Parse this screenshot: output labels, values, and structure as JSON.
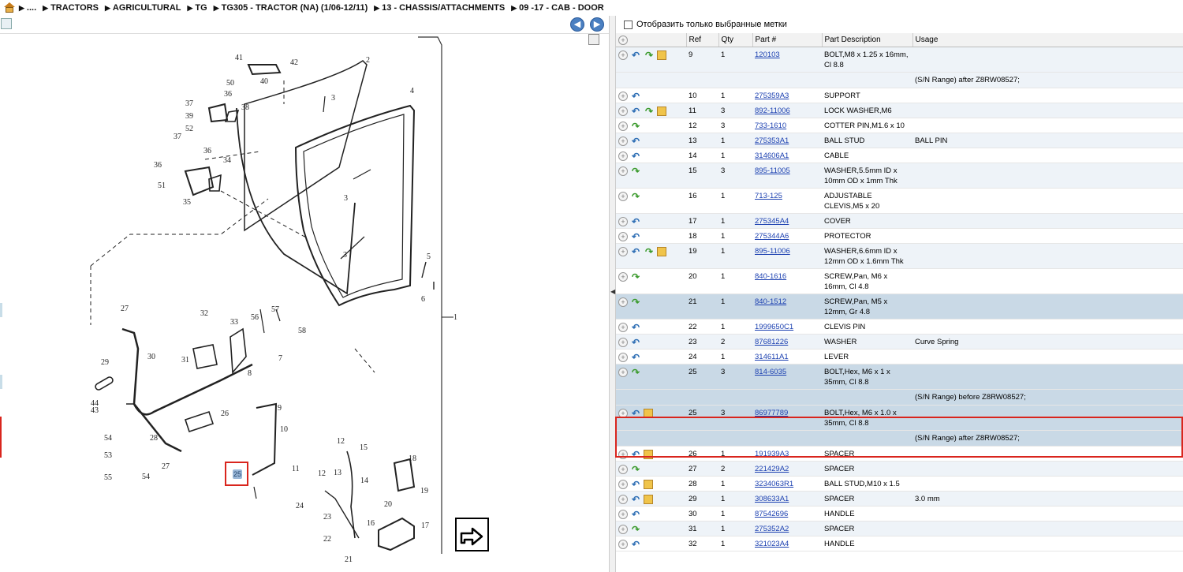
{
  "breadcrumb": {
    "items": [
      "....",
      "TRACTORS",
      "AGRICULTURAL",
      "TG",
      "TG305 - TRACTOR (NA) (1/06-12/11)",
      "13 - CHASSIS/ATTACHMENTS",
      "09 -17 - CAB - DOOR"
    ]
  },
  "nav": {
    "back": "◀",
    "forward": "▶"
  },
  "filter": {
    "label": "Отобразить только выбранные метки"
  },
  "table": {
    "headers": [
      "Ref",
      "Qty",
      "Part #",
      "Part Description",
      "Usage"
    ],
    "rows": [
      {
        "icons": [
          "plus",
          "back",
          "fwd",
          "box"
        ],
        "ref": "9",
        "qty": "1",
        "part": "120103",
        "desc": "BOLT,M8 x 1.25 x 16mm, Cl 8.8",
        "usage": "",
        "style": "alt"
      },
      {
        "range": "(S/N Range) after Z8RW08527;",
        "style": "alt"
      },
      {
        "icons": [
          "plus",
          "back"
        ],
        "ref": "10",
        "qty": "1",
        "part": "275359A3",
        "desc": "SUPPORT",
        "usage": "",
        "style": "white"
      },
      {
        "icons": [
          "plus",
          "back",
          "fwd",
          "box"
        ],
        "ref": "11",
        "qty": "3",
        "part": "892-11006",
        "desc": "LOCK WASHER,M6",
        "usage": "",
        "style": "alt"
      },
      {
        "icons": [
          "plus",
          "fwd"
        ],
        "ref": "12",
        "qty": "3",
        "part": "733-1610",
        "desc": "COTTER PIN,M1.6 x 10",
        "usage": "",
        "style": "white"
      },
      {
        "icons": [
          "plus",
          "back"
        ],
        "ref": "13",
        "qty": "1",
        "part": "275353A1",
        "desc": "BALL STUD",
        "usage": "BALL PIN",
        "style": "alt"
      },
      {
        "icons": [
          "plus",
          "back"
        ],
        "ref": "14",
        "qty": "1",
        "part": "314606A1",
        "desc": "CABLE",
        "usage": "",
        "style": "white"
      },
      {
        "icons": [
          "plus",
          "fwd"
        ],
        "ref": "15",
        "qty": "3",
        "part": "895-11005",
        "desc": "WASHER,5.5mm ID x 10mm OD x 1mm Thk",
        "usage": "",
        "style": "alt"
      },
      {
        "icons": [
          "plus",
          "fwd"
        ],
        "ref": "16",
        "qty": "1",
        "part": "713-125",
        "desc": "ADJUSTABLE CLEVIS,M5 x 20",
        "usage": "",
        "style": "white"
      },
      {
        "icons": [
          "plus",
          "back"
        ],
        "ref": "17",
        "qty": "1",
        "part": "275345A4",
        "desc": "COVER",
        "usage": "",
        "style": "alt"
      },
      {
        "icons": [
          "plus",
          "back"
        ],
        "ref": "18",
        "qty": "1",
        "part": "275344A6",
        "desc": "PROTECTOR",
        "usage": "",
        "style": "white"
      },
      {
        "icons": [
          "plus",
          "back",
          "fwd",
          "box"
        ],
        "ref": "19",
        "qty": "1",
        "part": "895-11006",
        "desc": "WASHER,6.6mm ID x 12mm OD x 1.6mm Thk",
        "usage": "",
        "style": "alt"
      },
      {
        "icons": [
          "plus",
          "fwd"
        ],
        "ref": "20",
        "qty": "1",
        "part": "840-1616",
        "desc": "SCREW,Pan, M6 x 16mm, Cl 4.8",
        "usage": "",
        "style": "white"
      },
      {
        "icons": [
          "plus",
          "fwd"
        ],
        "ref": "21",
        "qty": "1",
        "part": "840-1512",
        "desc": "SCREW,Pan, M5 x 12mm, Gr 4.8",
        "usage": "",
        "style": "sel"
      },
      {
        "icons": [
          "plus",
          "back"
        ],
        "ref": "22",
        "qty": "1",
        "part": "1999650C1",
        "desc": "CLEVIS PIN",
        "usage": "",
        "style": "white"
      },
      {
        "icons": [
          "plus",
          "back"
        ],
        "ref": "23",
        "qty": "2",
        "part": "87681226",
        "desc": "WASHER",
        "usage": "Curve Spring",
        "style": "alt"
      },
      {
        "icons": [
          "plus",
          "back"
        ],
        "ref": "24",
        "qty": "1",
        "part": "314611A1",
        "desc": "LEVER",
        "usage": "",
        "style": "white"
      },
      {
        "icons": [
          "plus",
          "fwd"
        ],
        "ref": "25",
        "qty": "3",
        "part": "814-6035",
        "desc": "BOLT,Hex, M6 x 1 x 35mm, Cl 8.8",
        "usage": "",
        "style": "sel"
      },
      {
        "range": "(S/N Range) before Z8RW08527;",
        "style": "sel"
      },
      {
        "icons": [
          "plus",
          "back",
          "box"
        ],
        "ref": "25",
        "qty": "3",
        "part": "86977789",
        "desc": "BOLT,Hex, M6 x 1.0 x 35mm, Cl 8.8",
        "usage": "",
        "style": "sel"
      },
      {
        "range": "(S/N Range) after Z8RW08527;",
        "style": "sel"
      },
      {
        "icons": [
          "plus",
          "back",
          "box"
        ],
        "ref": "26",
        "qty": "1",
        "part": "191939A3",
        "desc": "SPACER",
        "usage": "",
        "style": "white"
      },
      {
        "icons": [
          "plus",
          "fwd"
        ],
        "ref": "27",
        "qty": "2",
        "part": "221429A2",
        "desc": "SPACER",
        "usage": "",
        "style": "alt"
      },
      {
        "icons": [
          "plus",
          "back",
          "box"
        ],
        "ref": "28",
        "qty": "1",
        "part": "3234063R1",
        "desc": "BALL STUD,M10 x 1.5",
        "usage": "",
        "style": "white"
      },
      {
        "icons": [
          "plus",
          "back",
          "box"
        ],
        "ref": "29",
        "qty": "1",
        "part": "308633A1",
        "desc": "SPACER",
        "usage": "3.0 mm",
        "style": "alt"
      },
      {
        "icons": [
          "plus",
          "back"
        ],
        "ref": "30",
        "qty": "1",
        "part": "87542696",
        "desc": "HANDLE",
        "usage": "",
        "style": "white"
      },
      {
        "icons": [
          "plus",
          "fwd"
        ],
        "ref": "31",
        "qty": "1",
        "part": "275352A2",
        "desc": "SPACER",
        "usage": "",
        "style": "alt"
      },
      {
        "icons": [
          "plus",
          "back"
        ],
        "ref": "32",
        "qty": "1",
        "part": "321023A4",
        "desc": "HANDLE",
        "usage": "",
        "style": "white"
      }
    ]
  },
  "diagram": {
    "callouts": [
      "41",
      "42",
      "40",
      "50",
      "2",
      "36",
      "37",
      "39",
      "38",
      "52",
      "3",
      "4",
      "37",
      "36",
      "36",
      "34",
      "51",
      "35",
      "3",
      "3",
      "5",
      "6",
      "1",
      "27",
      "32",
      "33",
      "56",
      "57",
      "58",
      "31",
      "30",
      "29",
      "8",
      "7",
      "44",
      "43",
      "26",
      "9",
      "54",
      "28",
      "10",
      "53",
      "27",
      "11",
      "55",
      "12",
      "15",
      "18",
      "12",
      "13",
      "14",
      "19",
      "20",
      "24",
      "23",
      "16",
      "17",
      "22",
      "21"
    ],
    "selected_callout": "25",
    "exit_icon": "exit-arrow-icon"
  }
}
